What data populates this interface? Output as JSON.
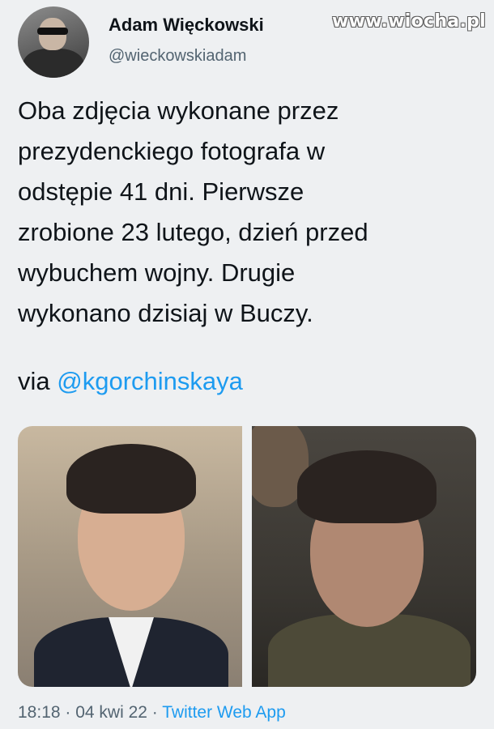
{
  "watermark": "www.wiocha.pl",
  "author": {
    "display_name": "Adam Więckowski",
    "handle": "@wieckowskiadam"
  },
  "tweet": {
    "lines": [
      "Oba zdjęcia wykonane przez",
      "prezydenckiego fotografa w",
      "odstępie 41 dni. Pierwsze",
      "zrobione 23 lutego, dzień przed",
      "wybuchem wojny. Drugie",
      "wykonano dzisiaj w Buczy."
    ],
    "via_prefix": "via ",
    "via_mention": "@kgorchinskaya"
  },
  "meta": {
    "time": "18:18",
    "separator": " · ",
    "date": "04 kwi 22",
    "source": "Twitter Web App"
  },
  "colors": {
    "link": "#1d9bf0",
    "secondary_text": "#536471",
    "background": "#eef0f2"
  }
}
